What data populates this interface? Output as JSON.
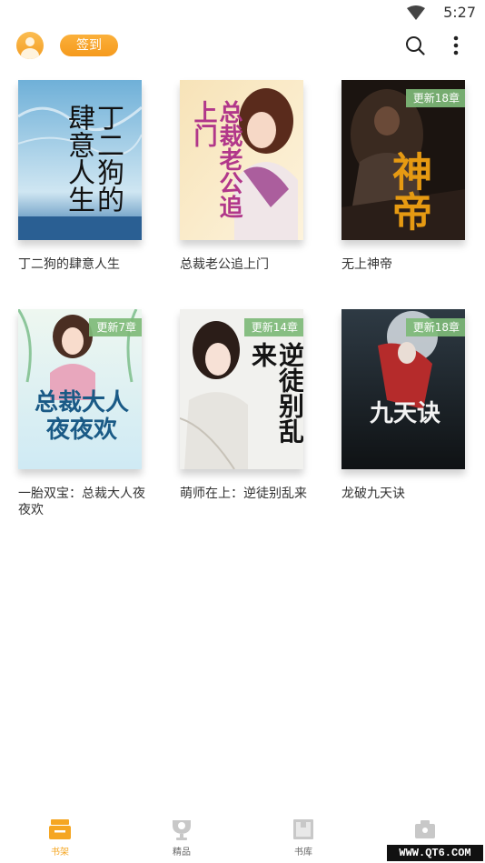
{
  "status_bar": {
    "time": "5:27",
    "icons": [
      "wifi-icon"
    ]
  },
  "header": {
    "signin_label": "签到",
    "icons": [
      "avatar",
      "search-icon",
      "more-icon"
    ]
  },
  "books": [
    {
      "title": "丁二狗的肆意人生",
      "badge": "",
      "cover_text": "丁二狗的肆意人生"
    },
    {
      "title": "总裁老公追上门",
      "badge": "",
      "cover_text": "总裁老公追上门"
    },
    {
      "title": "无上神帝",
      "badge": "更新18章",
      "cover_text": "神帝"
    },
    {
      "title": "一胎双宝：总裁大人夜夜欢",
      "badge": "更新7章",
      "cover_text": "总裁大人夜夜欢"
    },
    {
      "title": "萌师在上：逆徒别乱来",
      "badge": "更新14章",
      "cover_text": "逆徒别乱来"
    },
    {
      "title": "龙破九天诀",
      "badge": "更新18章",
      "cover_text": "九天诀"
    }
  ],
  "bottom_nav": [
    {
      "label": "书架",
      "icon": "bookshelf-icon",
      "active": true
    },
    {
      "label": "精品",
      "icon": "trophy-icon",
      "active": false
    },
    {
      "label": "书库",
      "icon": "library-icon",
      "active": false
    },
    {
      "label": "",
      "icon": "profile-icon",
      "active": false
    }
  ],
  "watermark": "WWW.QT6.COM",
  "colors": {
    "accent": "#f5a623",
    "badge": "#7eba78"
  }
}
